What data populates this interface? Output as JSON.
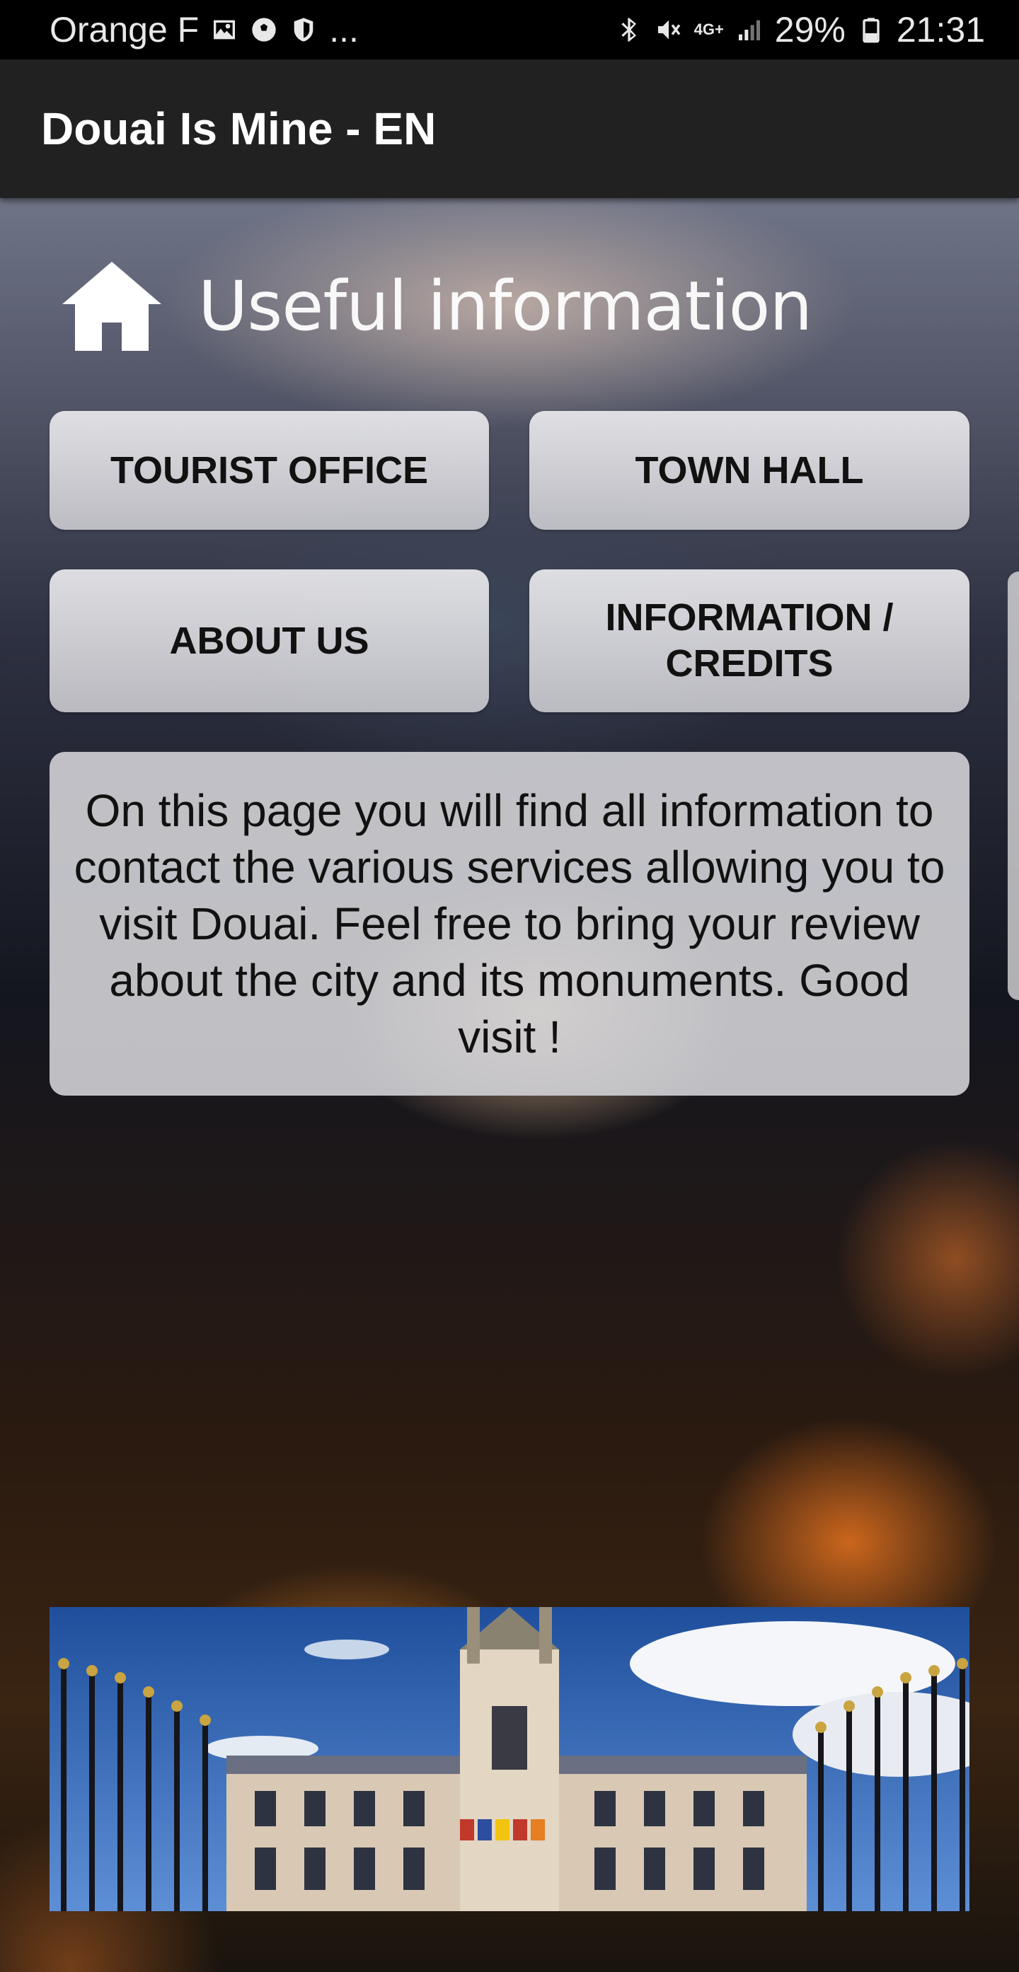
{
  "status_bar": {
    "carrier": "Orange F",
    "more": "...",
    "network": "4G+",
    "battery": "29%",
    "time": "21:31",
    "icons_left": [
      "gallery-icon",
      "soccer-icon",
      "shield-icon"
    ],
    "icons_right": [
      "bluetooth-icon",
      "mute-icon",
      "network-icon",
      "signal-icon",
      "battery-icon"
    ]
  },
  "app_bar": {
    "title": "Douai Is Mine - EN"
  },
  "section": {
    "icon": "home-icon",
    "title": "Useful information"
  },
  "buttons": {
    "tourist_office": "TOURIST OFFICE",
    "town_hall": "TOWN HALL",
    "about_us": "ABOUT US",
    "info_credits_line1": "INFORMATION /",
    "info_credits_line2": "CREDITS"
  },
  "info_text": "On this page you will find all information to contact the various services allowing you to visit Douai. Feel free to bring your review about the city and its monuments. Good visit !",
  "colors": {
    "app_bar_bg": "#212121",
    "status_bar_bg": "#000000",
    "button_bg": "#e0e0e3",
    "text_dark": "#111111"
  }
}
